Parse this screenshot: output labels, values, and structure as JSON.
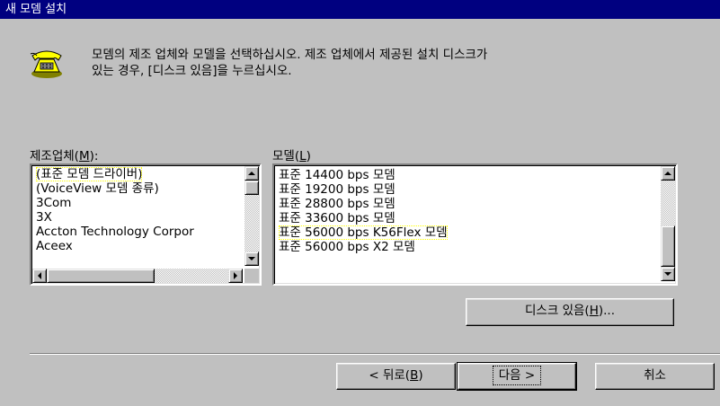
{
  "window": {
    "title": "새 모뎀 설치"
  },
  "instructions": {
    "line1": "모뎀의 제조 업체와 모델을 선택하십시오. 제조 업체에서 제공된 설치 디스크가",
    "line2": "있는 경우, [디스크 있음]을 누르십시오."
  },
  "manufacturer": {
    "label_before": "제조업체(",
    "label_key": "M",
    "label_after": "):",
    "items": [
      "(표준 모뎀 드라이버)",
      "(VoiceView 모뎀 종류)",
      "3Com",
      "3X",
      "Accton Technology Corpor",
      "Aceex"
    ],
    "selected_index": 0
  },
  "model": {
    "label_before": "모델(",
    "label_key": "L",
    "label_after": ")",
    "items": [
      "표준 14400 bps 모뎀",
      "표준 19200 bps 모뎀",
      "표준 28800 bps 모뎀",
      "표준 33600 bps 모뎀",
      "표준 56000 bps K56Flex 모뎀",
      "표준 56000 bps X2 모뎀"
    ],
    "selected_index": 4
  },
  "buttons": {
    "have_disk_before": "디스크 있음(",
    "have_disk_key": "H",
    "have_disk_after": ")...",
    "back_before": "< 뒤로(",
    "back_key": "B",
    "back_after": ")",
    "next": "다음 >",
    "cancel": "취소"
  },
  "colors": {
    "face": "#c0c0c0",
    "title_bg": "#000080",
    "selection": "#000080"
  },
  "icons": [
    "telephone-modem-icon",
    "scroll-up-arrow-icon",
    "scroll-down-arrow-icon",
    "scroll-left-arrow-icon",
    "scroll-right-arrow-icon"
  ]
}
